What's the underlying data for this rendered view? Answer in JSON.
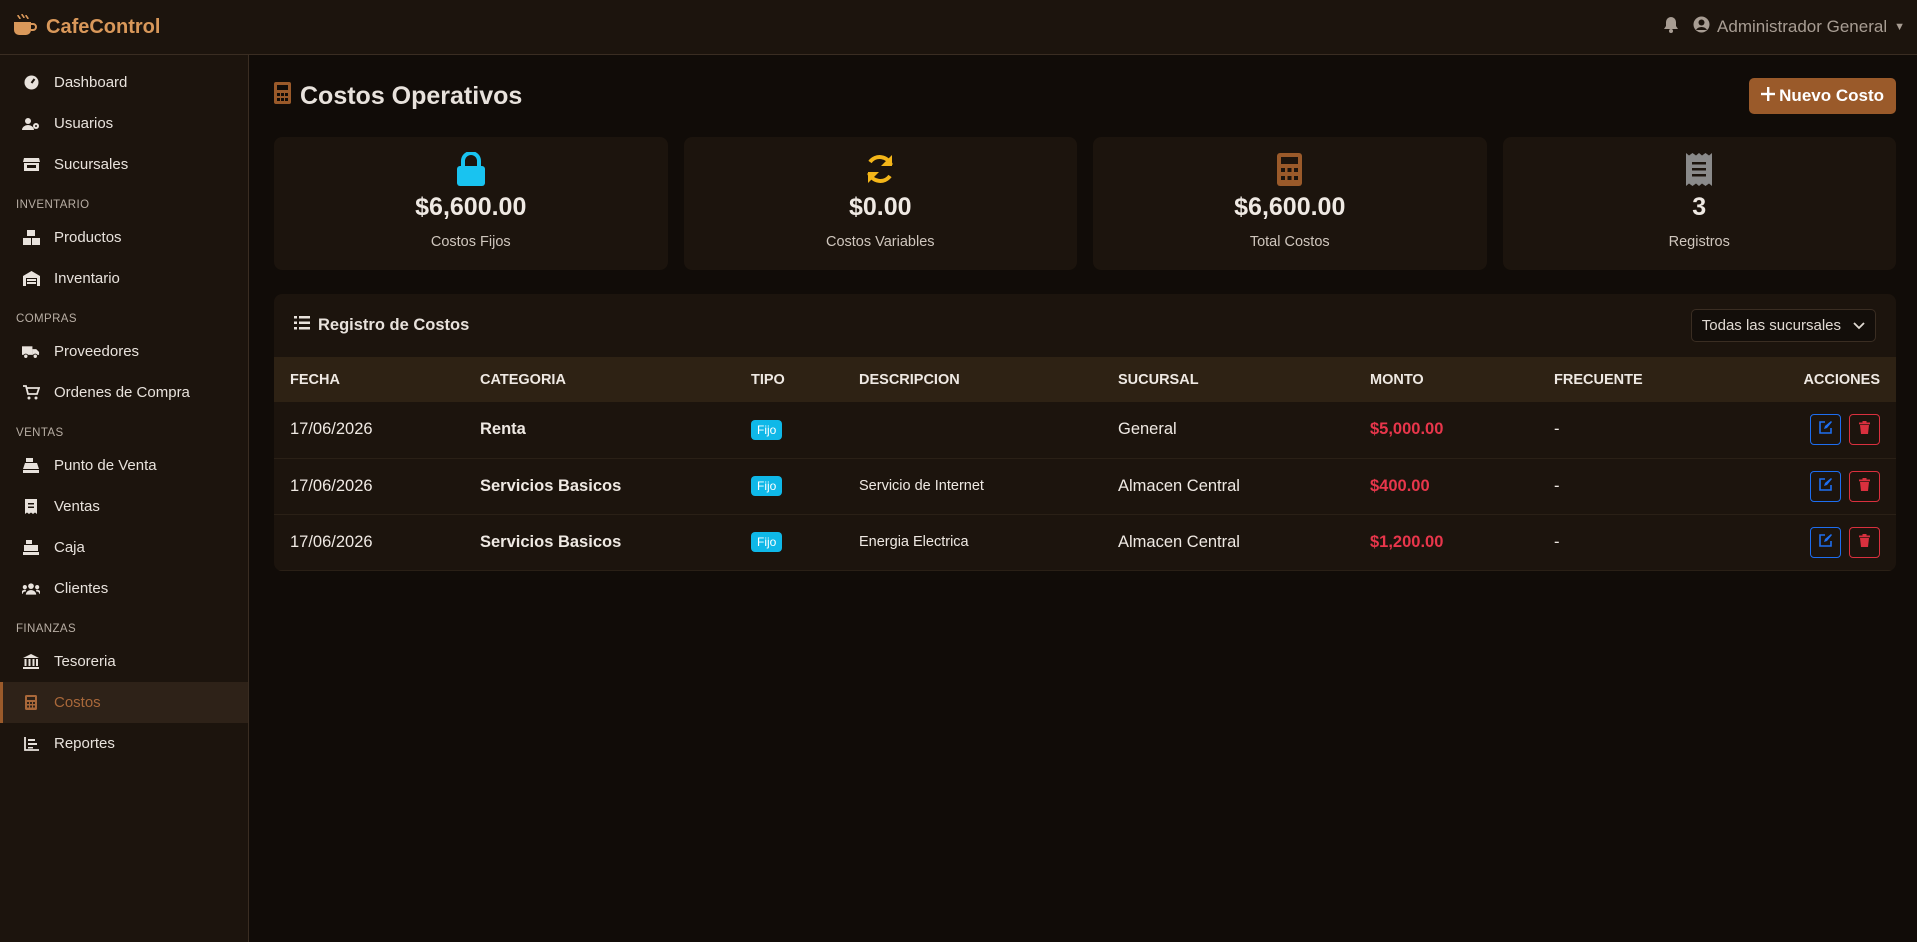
{
  "app": {
    "name": "CafeControl",
    "brand_color": "#d9985a"
  },
  "topbar": {
    "user_name": "Administrador General"
  },
  "sidebar": {
    "items": [
      {
        "key": "dashboard",
        "label": "Dashboard",
        "icon": "gauge-icon"
      },
      {
        "key": "usuarios",
        "label": "Usuarios",
        "icon": "users-cog-icon"
      },
      {
        "key": "sucursales",
        "label": "Sucursales",
        "icon": "store-icon"
      }
    ],
    "sections": [
      {
        "title": "INVENTARIO",
        "items": [
          {
            "key": "productos",
            "label": "Productos",
            "icon": "boxes-icon"
          },
          {
            "key": "inventario",
            "label": "Inventario",
            "icon": "warehouse-icon"
          }
        ]
      },
      {
        "title": "COMPRAS",
        "items": [
          {
            "key": "proveedores",
            "label": "Proveedores",
            "icon": "truck-icon"
          },
          {
            "key": "ordenes",
            "label": "Ordenes de Compra",
            "icon": "cart-icon"
          }
        ]
      },
      {
        "title": "VENTAS",
        "items": [
          {
            "key": "pos",
            "label": "Punto de Venta",
            "icon": "cash-register-icon"
          },
          {
            "key": "ventas",
            "label": "Ventas",
            "icon": "receipt-icon"
          },
          {
            "key": "caja",
            "label": "Caja",
            "icon": "cash-box-icon"
          },
          {
            "key": "clientes",
            "label": "Clientes",
            "icon": "users-icon"
          }
        ]
      },
      {
        "title": "FINANZAS",
        "items": [
          {
            "key": "tesoreria",
            "label": "Tesoreria",
            "icon": "bank-icon"
          },
          {
            "key": "costos",
            "label": "Costos",
            "icon": "calculator-icon",
            "active": true
          },
          {
            "key": "reportes",
            "label": "Reportes",
            "icon": "chart-bar-icon"
          }
        ]
      }
    ]
  },
  "page": {
    "title": "Costos Operativos",
    "new_button": "Nuevo Costo"
  },
  "stats": [
    {
      "value": "$6,600.00",
      "label": "Costos Fijos",
      "icon": "lock-icon",
      "color": "#19c3f0"
    },
    {
      "value": "$0.00",
      "label": "Costos Variables",
      "icon": "sync-icon",
      "color": "#f4b619"
    },
    {
      "value": "$6,600.00",
      "label": "Total Costos",
      "icon": "calculator-icon",
      "color": "#9a5a2a"
    },
    {
      "value": "3",
      "label": "Registros",
      "icon": "receipt-icon",
      "color": "#8a8a8a"
    }
  ],
  "panel": {
    "title": "Registro de Costos",
    "filter_value": "Todas las sucursales",
    "columns": [
      "FECHA",
      "CATEGORIA",
      "TIPO",
      "DESCRIPCION",
      "SUCURSAL",
      "MONTO",
      "FRECUENTE",
      "ACCIONES"
    ],
    "rows": [
      {
        "fecha": "17/06/2026",
        "categoria": "Renta",
        "tipo": "Fijo",
        "descripcion": "",
        "sucursal": "General",
        "monto": "$5,000.00",
        "frecuente": "-"
      },
      {
        "fecha": "17/06/2026",
        "categoria": "Servicios Basicos",
        "tipo": "Fijo",
        "descripcion": "Servicio de Internet",
        "sucursal": "Almacen Central",
        "monto": "$400.00",
        "frecuente": "-"
      },
      {
        "fecha": "17/06/2026",
        "categoria": "Servicios Basicos",
        "tipo": "Fijo",
        "descripcion": "Energia Electrica",
        "sucursal": "Almacen Central",
        "monto": "$1,200.00",
        "frecuente": "-"
      }
    ]
  }
}
